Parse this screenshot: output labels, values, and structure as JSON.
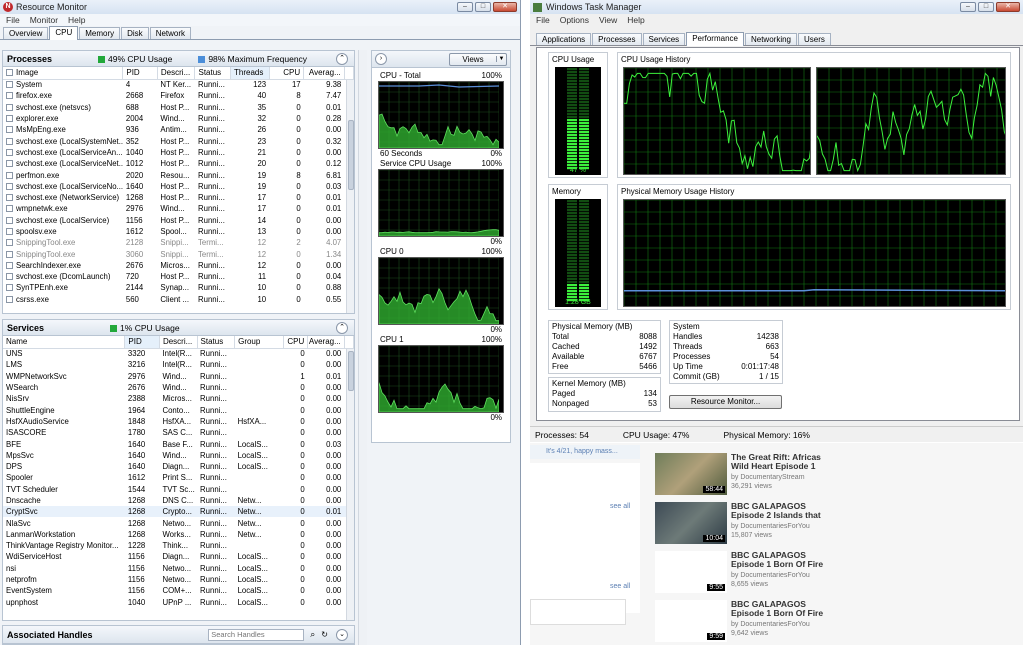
{
  "rm": {
    "title": "Resource Monitor",
    "menu": [
      "File",
      "Monitor",
      "Help"
    ],
    "tabs": [
      "Overview",
      "CPU",
      "Memory",
      "Disk",
      "Network"
    ],
    "processes": {
      "title": "Processes",
      "cpu": "49% CPU Usage",
      "freq": "98% Maximum Frequency",
      "cols": [
        "Image",
        "PID",
        "Descri...",
        "Status",
        "Threads",
        "CPU",
        "Averag..."
      ],
      "rows": [
        [
          "System",
          "4",
          "NT Ker...",
          "Runni...",
          "123",
          "17",
          "9.38"
        ],
        [
          "firefox.exe",
          "2668",
          "Firefox",
          "Runni...",
          "40",
          "8",
          "7.47"
        ],
        [
          "svchost.exe (netsvcs)",
          "688",
          "Host P...",
          "Runni...",
          "35",
          "0",
          "0.01"
        ],
        [
          "explorer.exe",
          "2004",
          "Wind...",
          "Runni...",
          "32",
          "0",
          "0.28"
        ],
        [
          "MsMpEng.exe",
          "936",
          "Antim...",
          "Runni...",
          "26",
          "0",
          "0.00"
        ],
        [
          "svchost.exe (LocalSystemNet...",
          "352",
          "Host P...",
          "Runni...",
          "23",
          "0",
          "0.32"
        ],
        [
          "svchost.exe (LocalServiceAn...",
          "1040",
          "Host P...",
          "Runni...",
          "21",
          "0",
          "0.00"
        ],
        [
          "svchost.exe (LocalServiceNet...",
          "1012",
          "Host P...",
          "Runni...",
          "20",
          "0",
          "0.12"
        ],
        [
          "perfmon.exe",
          "2020",
          "Resou...",
          "Runni...",
          "19",
          "8",
          "6.81"
        ],
        [
          "svchost.exe (LocalServiceNo...",
          "1640",
          "Host P...",
          "Runni...",
          "19",
          "0",
          "0.03"
        ],
        [
          "svchost.exe (NetworkService)",
          "1268",
          "Host P...",
          "Runni...",
          "17",
          "0",
          "0.01"
        ],
        [
          "wmpnetwk.exe",
          "2976",
          "Wind...",
          "Runni...",
          "17",
          "0",
          "0.01"
        ],
        [
          "svchost.exe (LocalService)",
          "1156",
          "Host P...",
          "Runni...",
          "14",
          "0",
          "0.00"
        ],
        [
          "spoolsv.exe",
          "1612",
          "Spool...",
          "Runni...",
          "13",
          "0",
          "0.00"
        ],
        [
          "SnippingTool.exe",
          "2128",
          "Snippi...",
          "Termi...",
          "12",
          "2",
          "4.07"
        ],
        [
          "SnippingTool.exe",
          "3060",
          "Snippi...",
          "Termi...",
          "12",
          "0",
          "1.34"
        ],
        [
          "SearchIndexer.exe",
          "2676",
          "Micros...",
          "Runni...",
          "12",
          "0",
          "0.00"
        ],
        [
          "svchost.exe (DcomLaunch)",
          "720",
          "Host P...",
          "Runni...",
          "11",
          "0",
          "0.04"
        ],
        [
          "SynTPEnh.exe",
          "2144",
          "Synap...",
          "Runni...",
          "10",
          "0",
          "0.88"
        ],
        [
          "csrss.exe",
          "560",
          "Client ...",
          "Runni...",
          "10",
          "0",
          "0.55"
        ]
      ]
    },
    "services": {
      "title": "Services",
      "cpu": "1% CPU Usage",
      "cols": [
        "Name",
        "PID",
        "Descri...",
        "Status",
        "Group",
        "CPU",
        "Averag..."
      ],
      "rows": [
        [
          "UNS",
          "3320",
          "Intel(R...",
          "Runni...",
          "",
          "0",
          "0.00"
        ],
        [
          "LMS",
          "3216",
          "Intel(R...",
          "Runni...",
          "",
          "0",
          "0.00"
        ],
        [
          "WMPNetworkSvc",
          "2976",
          "Wind...",
          "Runni...",
          "",
          "1",
          "0.01"
        ],
        [
          "WSearch",
          "2676",
          "Wind...",
          "Runni...",
          "",
          "0",
          "0.00"
        ],
        [
          "NisSrv",
          "2388",
          "Micros...",
          "Runni...",
          "",
          "0",
          "0.00"
        ],
        [
          "ShuttleEngine",
          "1964",
          "Conto...",
          "Runni...",
          "",
          "0",
          "0.00"
        ],
        [
          "HsfXAudioService",
          "1848",
          "HsfXA...",
          "Runni...",
          "HsfXA...",
          "0",
          "0.00"
        ],
        [
          "ISASCORE",
          "1780",
          "SAS C...",
          "Runni...",
          "",
          "0",
          "0.00"
        ],
        [
          "BFE",
          "1640",
          "Base F...",
          "Runni...",
          "LocalS...",
          "0",
          "0.03"
        ],
        [
          "MpsSvc",
          "1640",
          "Wind...",
          "Runni...",
          "LocalS...",
          "0",
          "0.00"
        ],
        [
          "DPS",
          "1640",
          "Diagn...",
          "Runni...",
          "LocalS...",
          "0",
          "0.00"
        ],
        [
          "Spooler",
          "1612",
          "Print S...",
          "Runni...",
          "",
          "0",
          "0.00"
        ],
        [
          "TVT Scheduler",
          "1544",
          "TVT Sc...",
          "Runni...",
          "",
          "0",
          "0.00"
        ],
        [
          "Dnscache",
          "1268",
          "DNS C...",
          "Runni...",
          "Netw...",
          "0",
          "0.00"
        ],
        [
          "CryptSvc",
          "1268",
          "Crypto...",
          "Runni...",
          "Netw...",
          "0",
          "0.01"
        ],
        [
          "NlaSvc",
          "1268",
          "Netwo...",
          "Runni...",
          "Netw...",
          "0",
          "0.00"
        ],
        [
          "LanmanWorkstation",
          "1268",
          "Works...",
          "Runni...",
          "Netw...",
          "0",
          "0.00"
        ],
        [
          "ThinkVantage Registry Monitor...",
          "1228",
          "Think...",
          "Runni...",
          "",
          "0",
          "0.00"
        ],
        [
          "WdiServiceHost",
          "1156",
          "Diagn...",
          "Runni...",
          "LocalS...",
          "0",
          "0.00"
        ],
        [
          "nsi",
          "1156",
          "Netwo...",
          "Runni...",
          "LocalS...",
          "0",
          "0.00"
        ],
        [
          "netprofm",
          "1156",
          "Netwo...",
          "Runni...",
          "LocalS...",
          "0",
          "0.00"
        ],
        [
          "EventSystem",
          "1156",
          "COM+...",
          "Runni...",
          "LocalS...",
          "0",
          "0.00"
        ],
        [
          "upnphost",
          "1040",
          "UPnP ...",
          "Runni...",
          "LocalS...",
          "0",
          "0.00"
        ]
      ]
    },
    "handles": {
      "title": "Associated Handles",
      "search_placeholder": "Search Handles"
    },
    "views_label": "Views",
    "graphs": [
      {
        "title": "CPU - Total",
        "max": "100%",
        "min": "0%",
        "footer": "60 Seconds"
      },
      {
        "title": "Service CPU Usage",
        "max": "100%",
        "min": "0%"
      },
      {
        "title": "CPU 0",
        "max": "100%",
        "min": "0%"
      },
      {
        "title": "CPU 1",
        "max": "100%",
        "min": "0%"
      }
    ]
  },
  "tm": {
    "title": "Windows Task Manager",
    "menu": [
      "File",
      "Options",
      "View",
      "Help"
    ],
    "tabs": [
      "Applications",
      "Processes",
      "Services",
      "Performance",
      "Networking",
      "Users"
    ],
    "cpu_usage_label": "CPU Usage",
    "cpu_usage_value": "47 %",
    "cpu_usage_fraction": 0.47,
    "cpu_history_label": "CPU Usage History",
    "memory_label": "Memory",
    "memory_value": "1.28 GB",
    "memory_fraction": 0.16,
    "memory_history_label": "Physical Memory Usage History",
    "physical_memory": {
      "title": "Physical Memory (MB)",
      "rows": [
        [
          "Total",
          "8088"
        ],
        [
          "Cached",
          "1492"
        ],
        [
          "Available",
          "6767"
        ],
        [
          "Free",
          "5466"
        ]
      ]
    },
    "kernel_memory": {
      "title": "Kernel Memory (MB)",
      "rows": [
        [
          "Paged",
          "134"
        ],
        [
          "Nonpaged",
          "53"
        ]
      ]
    },
    "system": {
      "title": "System",
      "rows": [
        [
          "Handles",
          "14238"
        ],
        [
          "Threads",
          "663"
        ],
        [
          "Processes",
          "54"
        ],
        [
          "Up Time",
          "0:01:17:48"
        ],
        [
          "Commit (GB)",
          "1 / 15"
        ]
      ]
    },
    "resource_monitor_button": "Resource Monitor...",
    "status": [
      "Processes: 54",
      "CPU Usage: 47%",
      "Physical Memory: 16%"
    ]
  },
  "bg": {
    "happy_text": "It's 4/21, happy mass...",
    "see_all": "see all",
    "videos": [
      {
        "title": "The Great Rift: Africas Wild Heart Episode 1",
        "by": "by DocumentaryStream",
        "views": "36,291 views",
        "duration": "58:44"
      },
      {
        "title": "BBC GALAPAGOS Episode 2 Islands that",
        "by": "by DocumentariesForYou",
        "views": "15,807 views",
        "duration": "10:04"
      },
      {
        "title": "BBC GALAPAGOS Episode 1 Born Of Fire",
        "by": "by DocumentariesForYou",
        "views": "8,655 views",
        "duration": "9:55"
      },
      {
        "title": "BBC GALAPAGOS Episode 1 Born Of Fire",
        "by": "by DocumentariesForYou",
        "views": "9,642 views",
        "duration": "9:59"
      }
    ]
  }
}
